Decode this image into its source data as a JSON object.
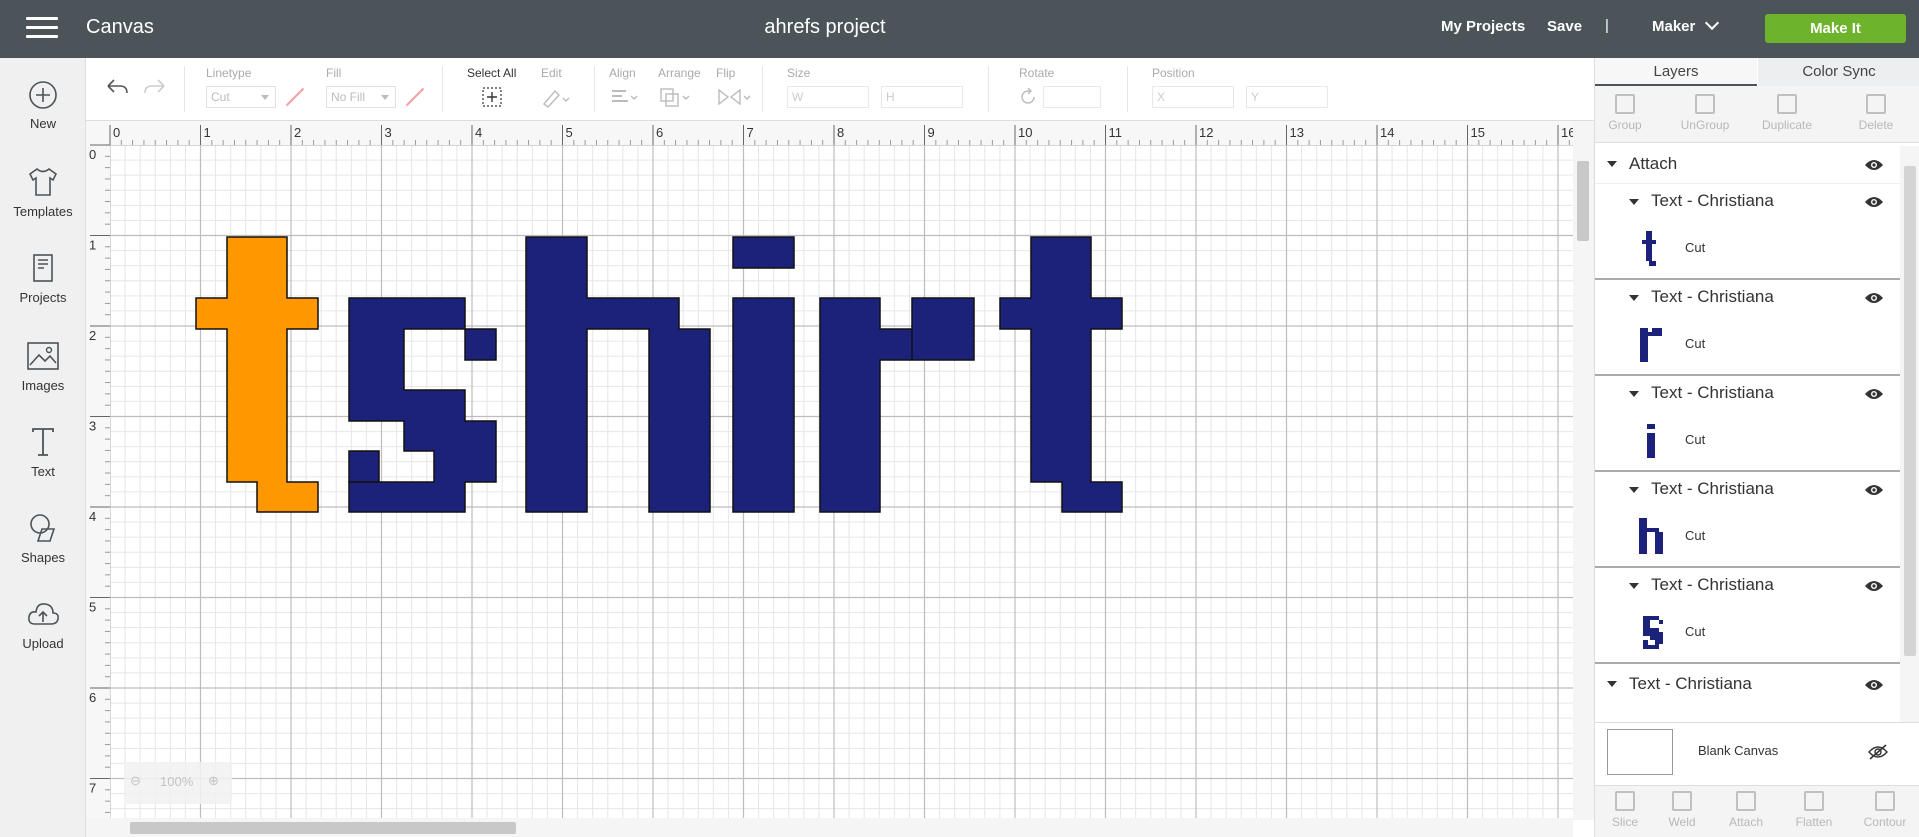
{
  "header": {
    "app_title": "Canvas",
    "project_title": "ahrefs project",
    "my_projects": "My Projects",
    "save": "Save",
    "divider": "|",
    "machine": "Maker",
    "make_it": "Make It",
    "bg_color": "#4b5459",
    "accent_color": "#6db32c"
  },
  "sidebar": {
    "items": [
      {
        "label": "New",
        "icon": "plus-circle-icon"
      },
      {
        "label": "Templates",
        "icon": "tshirt-icon"
      },
      {
        "label": "Projects",
        "icon": "projects-icon"
      },
      {
        "label": "Images",
        "icon": "image-icon"
      },
      {
        "label": "Text",
        "icon": "text-icon"
      },
      {
        "label": "Shapes",
        "icon": "shapes-icon"
      },
      {
        "label": "Upload",
        "icon": "cloud-upload-icon"
      }
    ]
  },
  "toolbar": {
    "linetype_label": "Linetype",
    "linetype_value": "Cut",
    "fill_label": "Fill",
    "fill_value": "No Fill",
    "select_all": "Select All",
    "edit": "Edit",
    "align": "Align",
    "arrange": "Arrange",
    "flip": "Flip",
    "size": "Size",
    "w": "W",
    "h": "H",
    "rotate": "Rotate",
    "position": "Position",
    "x": "X",
    "y": "Y"
  },
  "canvas": {
    "ruler_h": [
      "0",
      "1",
      "2",
      "3",
      "4",
      "5",
      "6",
      "7",
      "8",
      "9",
      "10",
      "11",
      "12",
      "13",
      "14",
      "15",
      "16"
    ],
    "ruler_v": [
      "0",
      "1",
      "2",
      "3",
      "4",
      "5",
      "6",
      "7"
    ],
    "design_text": "tshirt",
    "letter_colors": {
      "t_first": "#ff9800",
      "rest": "#1c2179"
    },
    "zoom": "100%"
  },
  "right_panel": {
    "tabs": [
      "Layers",
      "Color Sync"
    ],
    "actions": [
      "Group",
      "UnGroup",
      "Duplicate",
      "Delete"
    ],
    "group_name": "Attach",
    "layers": [
      {
        "name": "Text - Christiana",
        "glyph": "t",
        "op": "Cut"
      },
      {
        "name": "Text - Christiana",
        "glyph": "r",
        "op": "Cut"
      },
      {
        "name": "Text - Christiana",
        "glyph": "i",
        "op": "Cut"
      },
      {
        "name": "Text - Christiana",
        "glyph": "h",
        "op": "Cut"
      },
      {
        "name": "Text - Christiana",
        "glyph": "s",
        "op": "Cut"
      }
    ],
    "last_layer": "Text - Christiana",
    "blank_canvas": "Blank Canvas",
    "bottom_actions": [
      "Slice",
      "Weld",
      "Attach",
      "Flatten",
      "Contour"
    ]
  }
}
